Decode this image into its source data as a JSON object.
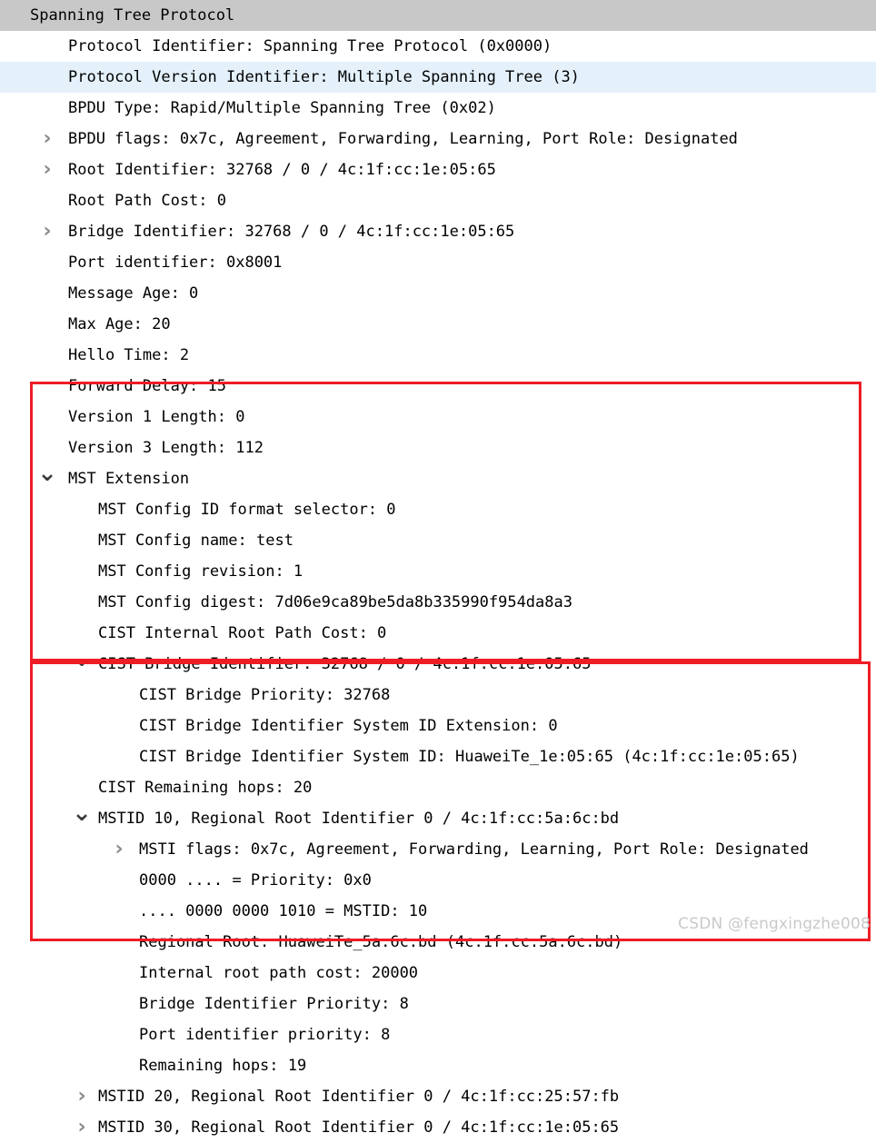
{
  "panel": {
    "title": "Spanning Tree Protocol",
    "selected_row_label": "Protocol Version Identifier: Multiple Spanning Tree (3)",
    "colors": {
      "header_selection": "#c8c8c8",
      "row_selection": "#e4f1fb",
      "annotation_box": "#ee1c25",
      "twisty": "#8a8a8a",
      "watermark": "#c9c9c9"
    }
  },
  "watermark": "CSDN @fengxingzhe008",
  "icons": {
    "collapsed": "chevron-right-icon",
    "expanded": "chevron-down-icon",
    "collapsed_glyph": "❯",
    "expanded_glyph": "❮"
  },
  "rows": [
    {
      "level": 0,
      "twisty": "expanded",
      "text": "Spanning Tree Protocol"
    },
    {
      "level": 1,
      "twisty": "none",
      "text": "Protocol Identifier: Spanning Tree Protocol (0x0000)"
    },
    {
      "level": 1,
      "twisty": "none",
      "text": "Protocol Version Identifier: Multiple Spanning Tree (3)"
    },
    {
      "level": 1,
      "twisty": "none",
      "text": "BPDU Type: Rapid/Multiple Spanning Tree (0x02)"
    },
    {
      "level": 1,
      "twisty": "collapsed",
      "text": "BPDU flags: 0x7c, Agreement, Forwarding, Learning, Port Role: Designated"
    },
    {
      "level": 1,
      "twisty": "collapsed",
      "text": "Root Identifier: 32768 / 0 / 4c:1f:cc:1e:05:65"
    },
    {
      "level": 1,
      "twisty": "none",
      "text": "Root Path Cost: 0"
    },
    {
      "level": 1,
      "twisty": "collapsed",
      "text": "Bridge Identifier: 32768 / 0 / 4c:1f:cc:1e:05:65"
    },
    {
      "level": 1,
      "twisty": "none",
      "text": "Port identifier: 0x8001"
    },
    {
      "level": 1,
      "twisty": "none",
      "text": "Message Age: 0"
    },
    {
      "level": 1,
      "twisty": "none",
      "text": "Max Age: 20"
    },
    {
      "level": 1,
      "twisty": "none",
      "text": "Hello Time: 2"
    },
    {
      "level": 1,
      "twisty": "none",
      "text": "Forward Delay: 15"
    },
    {
      "level": 1,
      "twisty": "none",
      "text": "Version 1 Length: 0"
    },
    {
      "level": 1,
      "twisty": "none",
      "text": "Version 3 Length: 112"
    },
    {
      "level": 1,
      "twisty": "expanded",
      "text": "MST Extension"
    },
    {
      "level": 2,
      "twisty": "none",
      "text": "MST Config ID format selector: 0"
    },
    {
      "level": 2,
      "twisty": "none",
      "text": "MST Config name: test"
    },
    {
      "level": 2,
      "twisty": "none",
      "text": "MST Config revision: 1"
    },
    {
      "level": 2,
      "twisty": "none",
      "text": "MST Config digest: 7d06e9ca89be5da8b335990f954da8a3"
    },
    {
      "level": 2,
      "twisty": "none",
      "text": "CIST Internal Root Path Cost: 0"
    },
    {
      "level": 2,
      "twisty": "expanded",
      "text": "CIST Bridge Identifier: 32768 / 0 / 4c:1f:cc:1e:05:65"
    },
    {
      "level": 3,
      "twisty": "none",
      "text": "CIST Bridge Priority: 32768"
    },
    {
      "level": 3,
      "twisty": "none",
      "text": "CIST Bridge Identifier System ID Extension: 0"
    },
    {
      "level": 3,
      "twisty": "none",
      "text": "CIST Bridge Identifier System ID: HuaweiTe_1e:05:65 (4c:1f:cc:1e:05:65)"
    },
    {
      "level": 2,
      "twisty": "none",
      "text": "CIST Remaining hops: 20"
    },
    {
      "level": 2,
      "twisty": "expanded",
      "text": "MSTID 10, Regional Root Identifier 0 / 4c:1f:cc:5a:6c:bd"
    },
    {
      "level": 3,
      "twisty": "collapsed",
      "text": "MSTI flags: 0x7c, Agreement, Forwarding, Learning, Port Role: Designated"
    },
    {
      "level": 3,
      "twisty": "none",
      "text": "0000 .... = Priority: 0x0"
    },
    {
      "level": 3,
      "twisty": "none",
      "text": ".... 0000 0000 1010 = MSTID: 10"
    },
    {
      "level": 3,
      "twisty": "none",
      "text": "Regional Root: HuaweiTe_5a:6c:bd (4c:1f:cc:5a:6c:bd)"
    },
    {
      "level": 3,
      "twisty": "none",
      "text": "Internal root path cost: 20000"
    },
    {
      "level": 3,
      "twisty": "none",
      "text": "Bridge Identifier Priority: 8"
    },
    {
      "level": 3,
      "twisty": "none",
      "text": "Port identifier priority: 8"
    },
    {
      "level": 3,
      "twisty": "none",
      "text": "Remaining hops: 19"
    },
    {
      "level": 2,
      "twisty": "collapsed",
      "text": "MSTID 20, Regional Root Identifier 0 / 4c:1f:cc:25:57:fb"
    },
    {
      "level": 2,
      "twisty": "collapsed",
      "text": "MSTID 30, Regional Root Identifier 0 / 4c:1f:cc:1e:05:65"
    }
  ]
}
